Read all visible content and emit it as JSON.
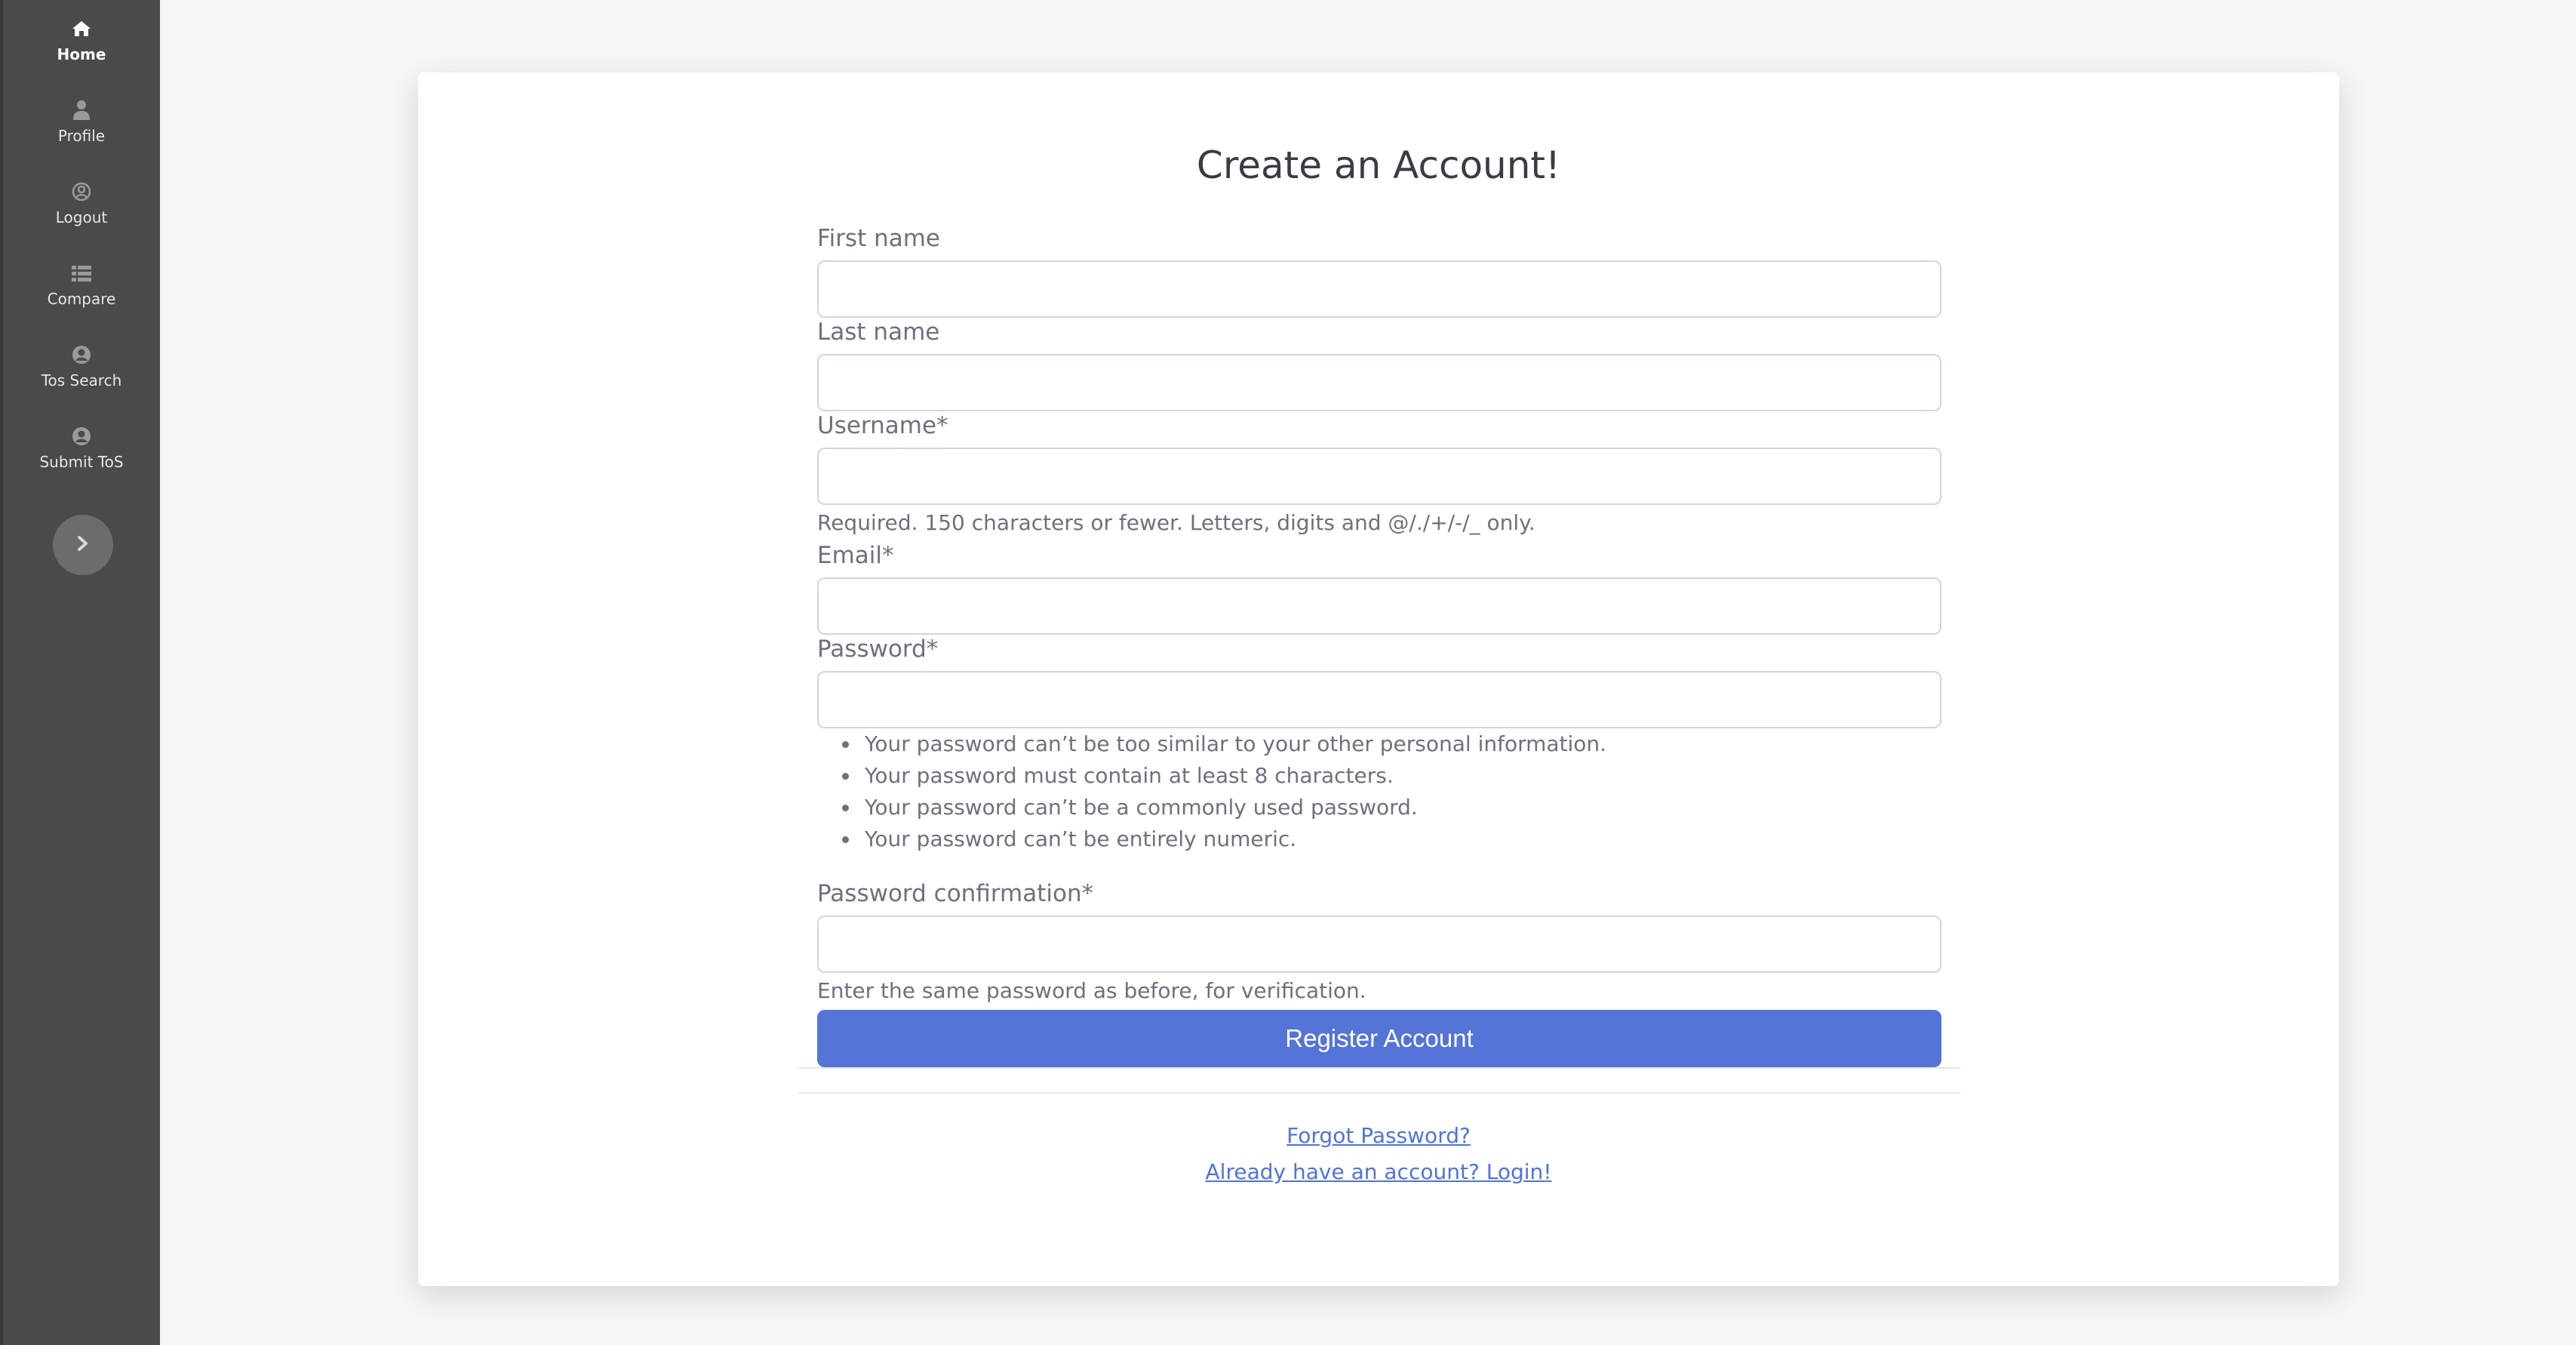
{
  "sidebar": {
    "items": [
      {
        "label": "Home",
        "icon": "home-icon",
        "active": true
      },
      {
        "label": "Profile",
        "icon": "user-icon"
      },
      {
        "label": "Logout",
        "icon": "user-circle-icon"
      },
      {
        "label": "Compare",
        "icon": "list-icon"
      },
      {
        "label": "Tos Search",
        "icon": "user-circle-icon"
      },
      {
        "label": "Submit ToS",
        "icon": "user-circle-icon"
      }
    ],
    "toggle_icon": "chevron-right-icon"
  },
  "form": {
    "title": "Create an Account!",
    "first_name_label": "First name",
    "last_name_label": "Last name",
    "username_label": "Username*",
    "username_help": "Required. 150 characters or fewer. Letters, digits and @/./+/-/_ only.",
    "email_label": "Email*",
    "password_label": "Password*",
    "password_rules": [
      "Your password can’t be too similar to your other personal information.",
      "Your password must contain at least 8 characters.",
      "Your password can’t be a commonly used password.",
      "Your password can’t be entirely numeric."
    ],
    "password_confirm_label": "Password confirmation*",
    "password_confirm_help": "Enter the same password as before, for verification.",
    "register_button": "Register Account"
  },
  "links": {
    "forgot_password": "Forgot Password?",
    "login": "Already have an account? Login!"
  },
  "colors": {
    "sidebar_bg": "#4a4a4a",
    "primary": "#5474d8",
    "link": "#4e73df"
  }
}
